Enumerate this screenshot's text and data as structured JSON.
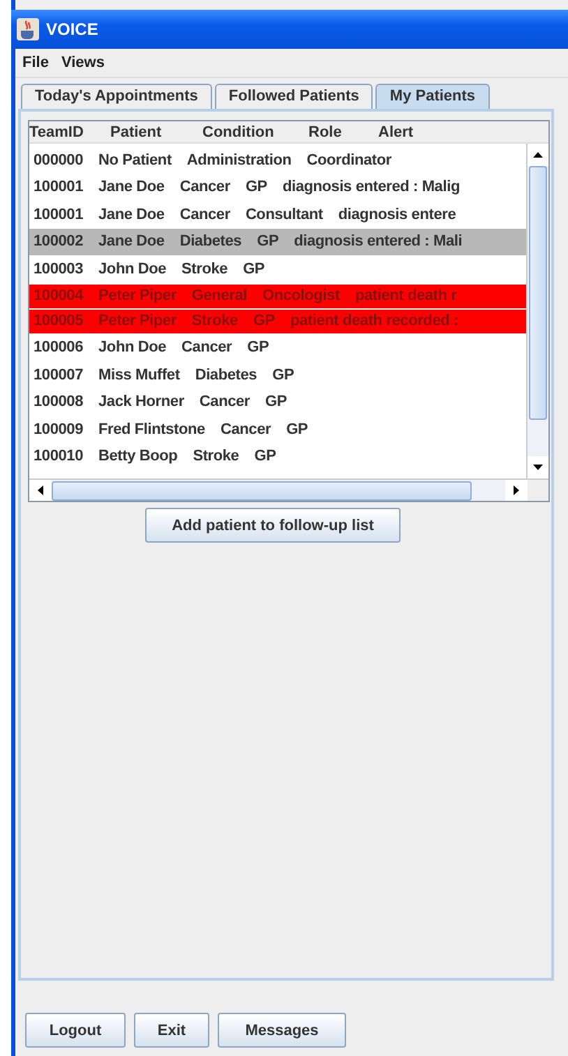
{
  "window": {
    "title": "VOICE"
  },
  "menu": [
    "File",
    "Views"
  ],
  "tabs": [
    {
      "label": "Today's Appointments",
      "selected": false
    },
    {
      "label": "Followed Patients",
      "selected": false
    },
    {
      "label": "My Patients",
      "selected": true
    }
  ],
  "list": {
    "columns": [
      "TeamID",
      "Patient",
      "Condition",
      "Role",
      "Alert"
    ],
    "rows": [
      {
        "cells": [
          "000000",
          "No Patient",
          "Administration",
          "Coordinator"
        ],
        "selected": false,
        "alert": false
      },
      {
        "cells": [
          "100001",
          "Jane Doe",
          "Cancer",
          "GP",
          "diagnosis entered : Malig"
        ],
        "selected": false,
        "alert": false
      },
      {
        "cells": [
          "100001",
          "Jane Doe",
          "Cancer",
          "Consultant",
          "diagnosis entere"
        ],
        "selected": false,
        "alert": false
      },
      {
        "cells": [
          "100002",
          "Jane Doe",
          "Diabetes",
          "GP",
          "diagnosis entered : Mali"
        ],
        "selected": true,
        "alert": false
      },
      {
        "cells": [
          "100003",
          "John Doe",
          "Stroke",
          "GP"
        ],
        "selected": false,
        "alert": false
      },
      {
        "cells": [
          "100004",
          "Peter Piper",
          "General",
          "Oncologist",
          "patient death r"
        ],
        "selected": false,
        "alert": true
      },
      {
        "cells": [
          "100005",
          "Peter Piper",
          "Stroke",
          "GP",
          "patient death recorded :"
        ],
        "selected": false,
        "alert": true
      },
      {
        "cells": [
          "100006",
          "John Doe",
          "Cancer",
          "GP"
        ],
        "selected": false,
        "alert": false
      },
      {
        "cells": [
          "100007",
          "Miss Muffet",
          "Diabetes",
          "GP"
        ],
        "selected": false,
        "alert": false
      },
      {
        "cells": [
          "100008",
          "Jack Horner",
          "Cancer",
          "GP"
        ],
        "selected": false,
        "alert": false
      },
      {
        "cells": [
          "100009",
          "Fred Flintstone",
          "Cancer",
          "GP"
        ],
        "selected": false,
        "alert": false
      },
      {
        "cells": [
          "100010",
          "Betty Boop",
          "Stroke",
          "GP"
        ],
        "selected": false,
        "alert": false
      }
    ]
  },
  "add_button": "Add patient to follow-up list",
  "footer_buttons": [
    "Logout",
    "Exit",
    "Messages"
  ]
}
